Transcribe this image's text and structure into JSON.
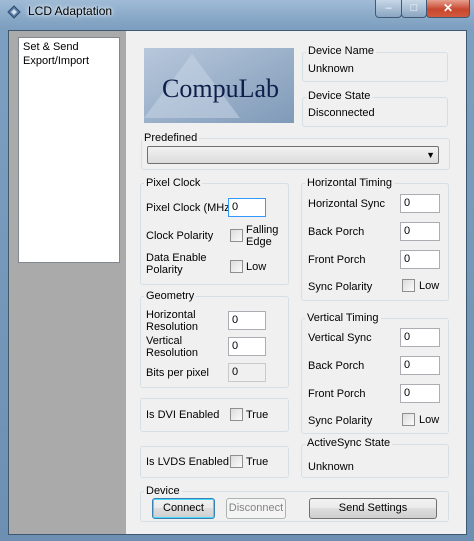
{
  "window": {
    "title": "LCD Adaptation",
    "min_glyph": "–",
    "max_glyph": "□",
    "close_glyph": "✕"
  },
  "nav": {
    "items": [
      "Set & Send",
      "Export/Import"
    ]
  },
  "logo": {
    "text": "CompuLab"
  },
  "device_name": {
    "label": "Device Name",
    "value": "Unknown"
  },
  "device_state": {
    "label": "Device State",
    "value": "Disconnected"
  },
  "predefined": {
    "label": "Predefined",
    "selected": ""
  },
  "pixel_clock": {
    "group": "Pixel Clock",
    "clock_label": "Pixel Clock (MHz)",
    "clock_value": "0",
    "polarity_label": "Clock Polarity",
    "polarity_option": "Falling Edge",
    "polarity_checked": false,
    "de_polarity_label": "Data Enable Polarity",
    "de_polarity_option": "Low",
    "de_polarity_checked": false
  },
  "geometry": {
    "group": "Geometry",
    "h_res_label": "Horizontal Resolution",
    "h_res_value": "0",
    "v_res_label": "Vertical Resolution",
    "v_res_value": "0",
    "bpp_label": "Bits per pixel",
    "bpp_value": "0"
  },
  "dvi": {
    "label": "Is DVI Enabled",
    "option": "True",
    "checked": false
  },
  "lvds": {
    "label": "Is LVDS Enabled",
    "option": "True",
    "checked": false
  },
  "horizontal_timing": {
    "group": "Horizontal Timing",
    "sync_label": "Horizontal Sync",
    "sync_value": "0",
    "back_porch_label": "Back Porch",
    "back_porch_value": "0",
    "front_porch_label": "Front Porch",
    "front_porch_value": "0",
    "polarity_label": "Sync Polarity",
    "polarity_option": "Low",
    "polarity_checked": false
  },
  "vertical_timing": {
    "group": "Vertical Timing",
    "sync_label": "Vertical Sync",
    "sync_value": "0",
    "back_porch_label": "Back Porch",
    "back_porch_value": "0",
    "front_porch_label": "Front Porch",
    "front_porch_value": "0",
    "polarity_label": "Sync Polarity",
    "polarity_option": "Low",
    "polarity_checked": false
  },
  "activesync": {
    "label": "ActiveSync State",
    "value": "Unknown"
  },
  "device_group": {
    "label": "Device",
    "connect": "Connect",
    "disconnect": "Disconnect",
    "send": "Send Settings"
  },
  "colors": {
    "panel": "#f0f0f0",
    "left_panel": "#aaaaaa",
    "close_button": "#c8472f",
    "frame": "#7d9fc0"
  }
}
